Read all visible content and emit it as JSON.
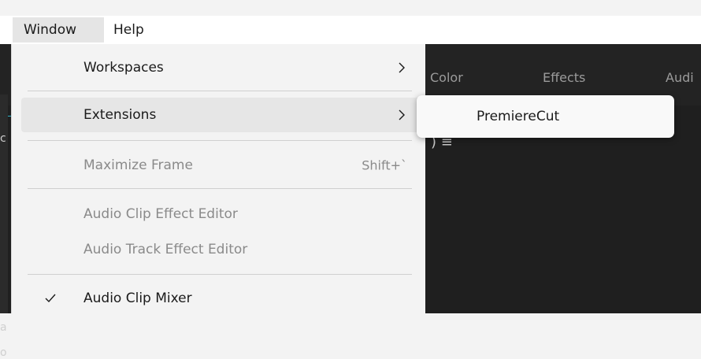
{
  "menubar": {
    "items": [
      {
        "label": "Window"
      },
      {
        "label": "Help"
      }
    ]
  },
  "background": {
    "workspace_tabs": [
      "Color",
      "Effects",
      "Audi"
    ],
    "panel_glyph": ") ≡"
  },
  "window_menu": {
    "workspaces": {
      "label": "Workspaces",
      "icon": "chevron-right-icon"
    },
    "extensions": {
      "label": "Extensions",
      "icon": "chevron-right-icon",
      "highlighted": true
    },
    "maximize_frame": {
      "label": "Maximize Frame",
      "shortcut": "Shift+`",
      "enabled": false
    },
    "audio_clip_effect_editor": {
      "label": "Audio Clip Effect Editor",
      "enabled": false
    },
    "audio_track_effect_editor": {
      "label": "Audio Track Effect Editor",
      "enabled": false
    },
    "audio_clip_mixer": {
      "label": "Audio Clip Mixer",
      "checked": true,
      "icon": "checkmark-icon"
    }
  },
  "extensions_submenu": {
    "items": [
      {
        "label": "PremiereCut"
      }
    ]
  },
  "colors": {
    "menu_bg": "#f3f3f3",
    "highlight_bg": "#e6e6e6",
    "app_bg_dark": "#1f1f1f",
    "disabled_text": "#8a8a8a",
    "accent_teal": "#2fb3c9"
  }
}
